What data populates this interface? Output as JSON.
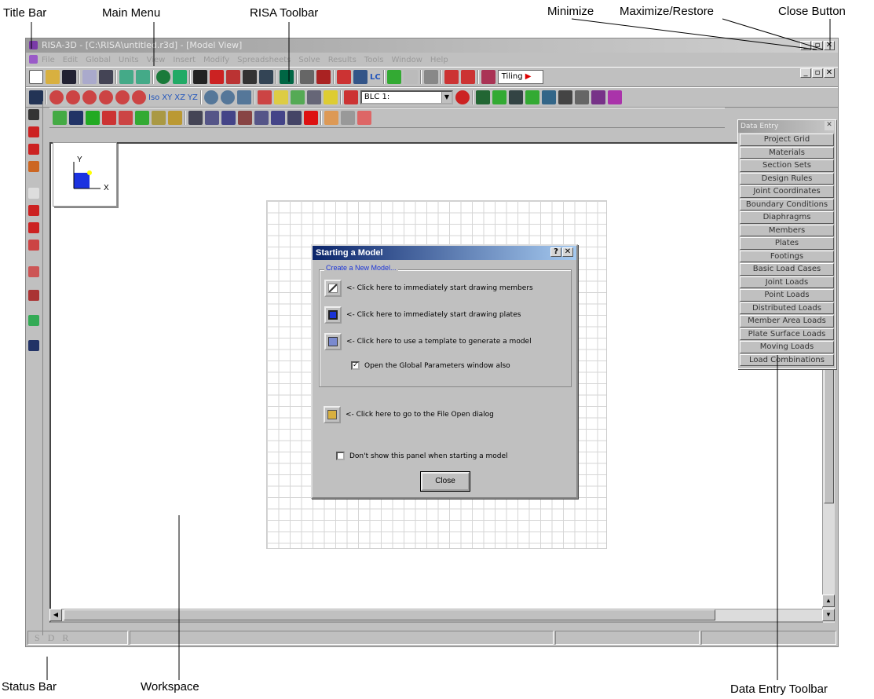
{
  "callouts": {
    "title_bar": "Title Bar",
    "main_menu": "Main Menu",
    "risa_toolbar": "RISA Toolbar",
    "minimize": "Minimize",
    "maximize_restore": "Maximize/Restore",
    "close_button": "Close Button",
    "status_bar": "Status Bar",
    "workspace": "Workspace",
    "data_entry_toolbar": "Data Entry Toolbar"
  },
  "window": {
    "title": "RISA-3D - [C:\\RISA\\untitled.r3d] - [Model View]"
  },
  "menu": [
    "File",
    "Edit",
    "Global",
    "Units",
    "View",
    "Insert",
    "Modify",
    "Spreadsheets",
    "Solve",
    "Results",
    "Tools",
    "Window",
    "Help"
  ],
  "toolbar2": {
    "iso": "Iso",
    "xy": "XY",
    "xz": "XZ",
    "yz": "YZ",
    "lc": "LC",
    "load_case": "BLC 1:",
    "tiling": "Tiling"
  },
  "axis_box": {
    "y": "Y",
    "x": "X"
  },
  "dialog": {
    "title": "Starting a Model",
    "group_label": "Create a New Model...",
    "option1": "<- Click here to immediately start drawing members",
    "option2": "<- Click here to immediately start drawing plates",
    "option3": "<- Click here to use a template to generate a model",
    "check1": "Open the Global Parameters window also",
    "option4": "<- Click here to go to the File Open dialog",
    "check2": "Don't show this panel when starting a model",
    "close": "Close"
  },
  "data_entry": {
    "title": "Data Entry",
    "items": [
      "Project Grid",
      "Materials",
      "Section Sets",
      "Design Rules",
      "Joint Coordinates",
      "Boundary Conditions",
      "Diaphragms",
      "Members",
      "Plates",
      "Footings",
      "Basic Load Cases",
      "Joint Loads",
      "Point Loads",
      "Distributed Loads",
      "Member Area Loads",
      "Plate Surface Loads",
      "Moving Loads",
      "Load Combinations"
    ]
  },
  "status_bar": {
    "cells": [
      "S",
      "D",
      "R"
    ]
  }
}
